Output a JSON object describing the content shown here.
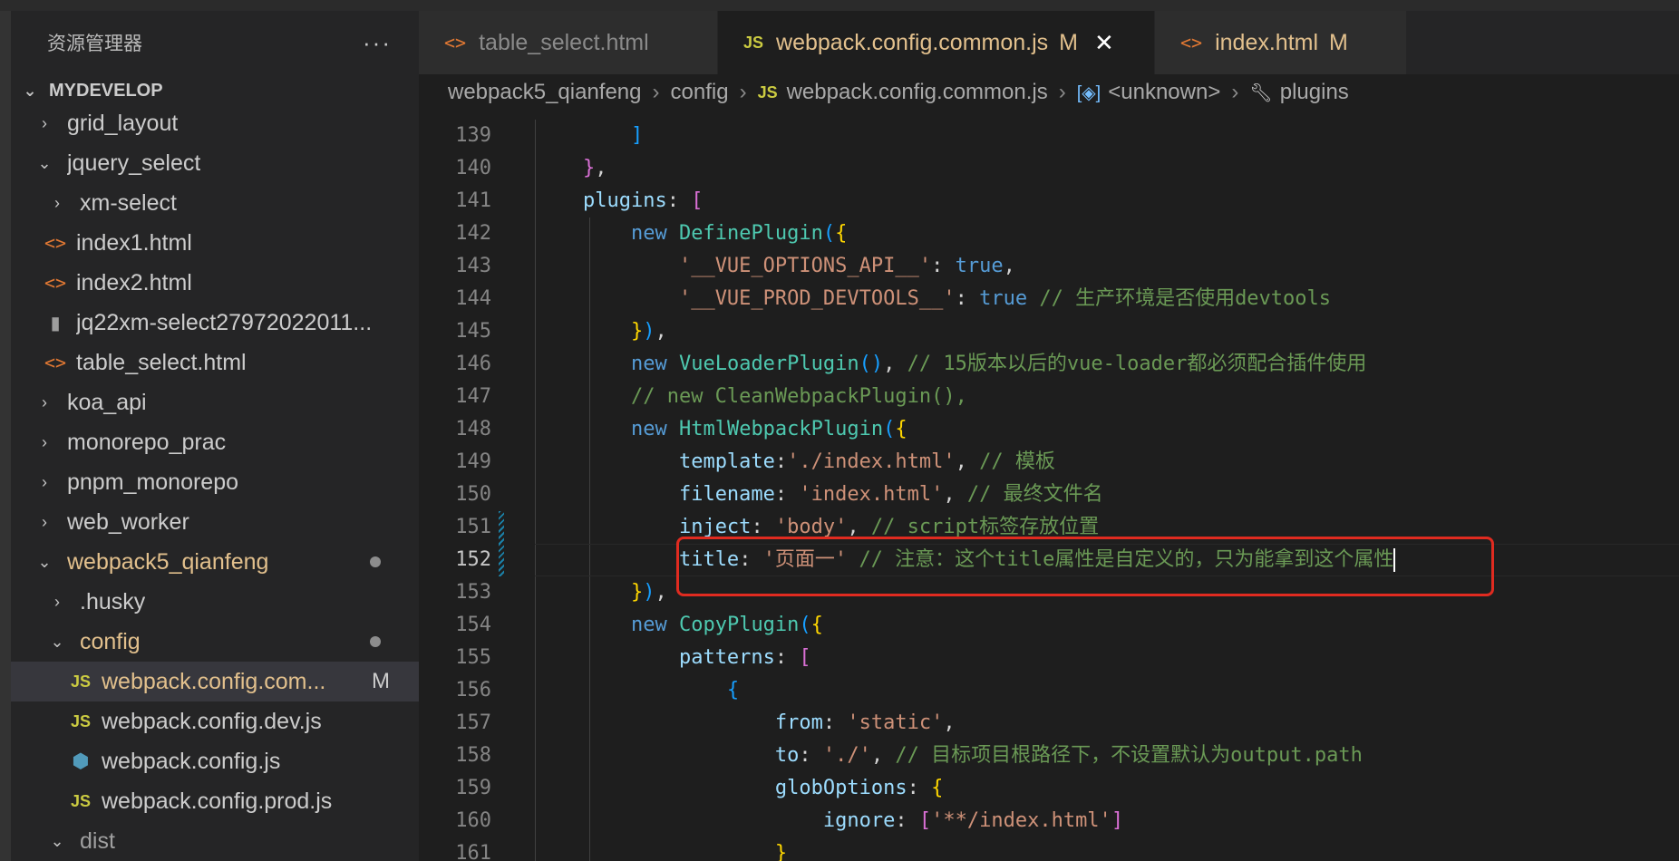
{
  "sidebar": {
    "title": "资源管理器",
    "more": "···",
    "root": "MYDEVELOP",
    "items": [
      {
        "label": "grid_layout",
        "type": "folder",
        "state": "collapsed",
        "level": 1
      },
      {
        "label": "jquery_select",
        "type": "folder",
        "state": "expanded",
        "level": 1
      },
      {
        "label": "xm-select",
        "type": "folder",
        "state": "collapsed",
        "level": 2
      },
      {
        "label": "index1.html",
        "type": "html",
        "level": 2
      },
      {
        "label": "index2.html",
        "type": "html",
        "level": 2
      },
      {
        "label": "jq22xm-select27972022011...",
        "type": "zip",
        "level": 2
      },
      {
        "label": "table_select.html",
        "type": "html",
        "level": 2
      },
      {
        "label": "koa_api",
        "type": "folder",
        "state": "collapsed",
        "level": 1
      },
      {
        "label": "monorepo_prac",
        "type": "folder",
        "state": "collapsed",
        "level": 1
      },
      {
        "label": "pnpm_monorepo",
        "type": "folder",
        "state": "collapsed",
        "level": 1
      },
      {
        "label": "web_worker",
        "type": "folder",
        "state": "collapsed",
        "level": 1
      },
      {
        "label": "webpack5_qianfeng",
        "type": "folder",
        "state": "expanded",
        "level": 1,
        "modified_dot": true
      },
      {
        "label": ".husky",
        "type": "folder",
        "state": "collapsed",
        "level": 2
      },
      {
        "label": "config",
        "type": "folder",
        "state": "expanded",
        "level": 2,
        "modified_dot": true
      },
      {
        "label": "webpack.config.com...",
        "type": "js",
        "level": 3,
        "selected": true,
        "badge": "M"
      },
      {
        "label": "webpack.config.dev.js",
        "type": "js",
        "level": 3
      },
      {
        "label": "webpack.config.js",
        "type": "gear",
        "level": 3
      },
      {
        "label": "webpack.config.prod.js",
        "type": "js",
        "level": 3
      },
      {
        "label": "dist",
        "type": "folder",
        "state": "expanded",
        "level": 2
      }
    ],
    "icons": {
      "html": "<>",
      "js": "JS",
      "chevron_right": "›",
      "chevron_down": "⌄"
    }
  },
  "tabs": [
    {
      "label": "table_select.html",
      "icon": "<>",
      "active": false,
      "modified": ""
    },
    {
      "label": "webpack.config.common.js",
      "icon": "JS",
      "active": true,
      "modified": "M",
      "close": "✕"
    },
    {
      "label": "index.html",
      "icon": "<>",
      "active": false,
      "modified": "M"
    }
  ],
  "breadcrumb": {
    "folder": "webpack5_qianfeng",
    "subfolder": "config",
    "file_icon": "JS",
    "file": "webpack.config.common.js",
    "symbol": "<unknown>",
    "property": "plugins"
  },
  "code": {
    "lines": [
      {
        "n": "139"
      },
      {
        "n": "140"
      },
      {
        "n": "141"
      },
      {
        "n": "142"
      },
      {
        "n": "143"
      },
      {
        "n": "144"
      },
      {
        "n": "145"
      },
      {
        "n": "146"
      },
      {
        "n": "147"
      },
      {
        "n": "148"
      },
      {
        "n": "149"
      },
      {
        "n": "150"
      },
      {
        "n": "151"
      },
      {
        "n": "152"
      },
      {
        "n": "153"
      },
      {
        "n": "154"
      },
      {
        "n": "155"
      },
      {
        "n": "156"
      },
      {
        "n": "157"
      },
      {
        "n": "158"
      },
      {
        "n": "159"
      },
      {
        "n": "160"
      },
      {
        "n": "161"
      }
    ],
    "t": {
      "l139": "]",
      "l140a": "}",
      "l140b": ",",
      "l141a": "plugins",
      "l141b": ": ",
      "l141c": "[",
      "new": "new",
      "l142a": "DefinePlugin",
      "l142b": "(",
      "l142c": "{",
      "l143a": "'__VUE_OPTIONS_API__'",
      "l143b": ": ",
      "l143c": "true",
      "l143d": ",",
      "l144a": "'__VUE_PROD_DEVTOOLS__'",
      "l144b": ": ",
      "l144c": "true",
      "l144d": "// 生产环境是否使用devtools",
      "l145a": "}",
      "l145b": ")",
      "l145c": ",",
      "l146a": "VueLoaderPlugin",
      "l146b": "()",
      "l146c": ",",
      "l146d": "// 15版本以后的vue-loader都必须配合插件使用",
      "l147": "// new CleanWebpackPlugin(),",
      "l148a": "HtmlWebpackPlugin",
      "l148b": "(",
      "l148c": "{",
      "l149a": "template",
      "l149b": ":",
      "l149c": "'./index.html'",
      "l149d": ",",
      "l149e": "// 模板",
      "l150a": "filename",
      "l150b": ": ",
      "l150c": "'index.html'",
      "l150d": ",",
      "l150e": "// 最终文件名",
      "l151a": "inject",
      "l151b": ": ",
      "l151c": "'body'",
      "l151d": ",",
      "l151e": "// script标签存放位置",
      "l152a": "title",
      "l152b": ": ",
      "l152c": "'页面一'",
      "l152d": "// 注意：这个title属性是自定义的，只为能拿到这个属性",
      "l153a": "}",
      "l153b": ")",
      "l153c": ",",
      "l154a": "CopyPlugin",
      "l154b": "(",
      "l154c": "{",
      "l155a": "patterns",
      "l155b": ": ",
      "l155c": "[",
      "l156": "{",
      "l157a": "from",
      "l157b": ": ",
      "l157c": "'static'",
      "l157d": ",",
      "l158a": "to",
      "l158b": ": ",
      "l158c": "'./'",
      "l158d": ",",
      "l158e": "// 目标项目根路径下，不设置默认为output.path",
      "l159a": "globOptions",
      "l159b": ": ",
      "l159c": "{",
      "l160a": "ignore",
      "l160b": ": ",
      "l160c": "[",
      "l160d": "'**/index.html'",
      "l160e": "]",
      "l161": "}"
    }
  },
  "colors": {
    "highlight_box": "#e02b20",
    "modified": "#e2c08d",
    "keyword": "#569cd6",
    "string": "#ce9178",
    "comment": "#6a9955"
  }
}
